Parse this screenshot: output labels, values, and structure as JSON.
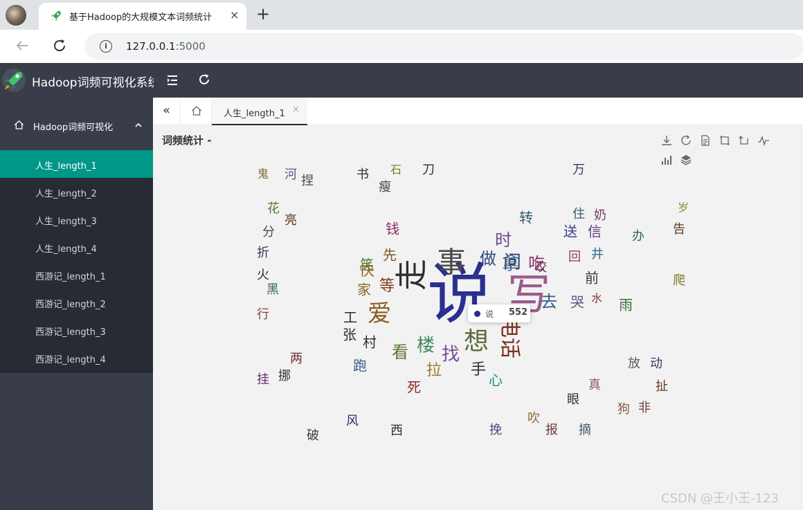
{
  "browser": {
    "tab_title": "基于Hadoop的大规模文本词频统计",
    "tab_close": "×",
    "new_tab": "+",
    "url_host": "127.0.0.1",
    "url_port": ":5000"
  },
  "app": {
    "title": "Hadoop词频可视化系统"
  },
  "sidebar": {
    "group_label": "Hadoop词频可视化",
    "items": [
      {
        "label": "人生_length_1",
        "active": true
      },
      {
        "label": "人生_length_2"
      },
      {
        "label": "人生_length_3"
      },
      {
        "label": "人生_length_4"
      },
      {
        "label": "西游记_length_1"
      },
      {
        "label": "西游记_length_2"
      },
      {
        "label": "西游记_length_3"
      },
      {
        "label": "西游记_length_4"
      }
    ]
  },
  "tabs": {
    "left_arrow": "«",
    "active_tab": "人生_length_1",
    "active_close": "×"
  },
  "chart": {
    "title": "词频统计 -",
    "tooltip": {
      "name": "说",
      "value": "552"
    }
  },
  "watermark": "CSDN @王小王-123",
  "colors": {
    "sidebar_active": "#009688",
    "header_bg": "#393d49",
    "sidebar_bg": "#282b33"
  },
  "chart_data": {
    "type": "wordcloud",
    "words": [
      {
        "text": "说",
        "value": 552,
        "color": "#2b2f8e"
      },
      {
        "text": "写",
        "color": "#9b5b8e"
      },
      {
        "text": "事",
        "color": "#4a4a4a"
      },
      {
        "text": "走",
        "color": "#2e2e2e"
      },
      {
        "text": "爱",
        "color": "#8a5b1e"
      },
      {
        "text": "想",
        "color": "#5a6a3a"
      },
      {
        "text": "电话",
        "color": "#7a2e1e"
      },
      {
        "text": "拿",
        "color": "#3b6c8a"
      },
      {
        "text": "吃",
        "color": "#8a2e6a"
      },
      {
        "text": "问",
        "color": "#3b3b6c"
      },
      {
        "text": "做",
        "color": "#2e4a8a"
      },
      {
        "text": "时",
        "color": "#6a4a8a"
      },
      {
        "text": "找",
        "color": "#7a4a9a"
      },
      {
        "text": "楼",
        "color": "#3b8a5a"
      },
      {
        "text": "去",
        "color": "#2e5a8a"
      },
      {
        "text": "快",
        "color": "#9a6a1e"
      },
      {
        "text": "看",
        "color": "#5a7a2e"
      },
      {
        "text": "等",
        "color": "#8a3b1e"
      },
      {
        "text": "拉",
        "color": "#9a7a1e"
      },
      {
        "text": "手",
        "color": "#2e2e2e"
      },
      {
        "text": "心",
        "color": "#1e8a8a"
      },
      {
        "text": "死",
        "color": "#8a2e2e"
      },
      {
        "text": "村",
        "color": "#2e2e2e"
      },
      {
        "text": "跑",
        "color": "#3b5a8a"
      },
      {
        "text": "家",
        "color": "#8a6a1e"
      },
      {
        "text": "笑",
        "color": "#4a7a2e"
      },
      {
        "text": "先",
        "color": "#7a5a1e"
      },
      {
        "text": "送",
        "color": "#3b3b8a"
      },
      {
        "text": "信",
        "color": "#5a3b8a"
      },
      {
        "text": "井",
        "color": "#2e6a8a"
      },
      {
        "text": "前",
        "color": "#3b3b3b"
      },
      {
        "text": "回",
        "color": "#8a3b6a"
      },
      {
        "text": "哭",
        "color": "#5a5a8a"
      },
      {
        "text": "水",
        "color": "#8a3b3b"
      },
      {
        "text": "雨",
        "color": "#3b6a3b"
      },
      {
        "text": "钱",
        "color": "#8a2e6a"
      },
      {
        "text": "吹",
        "color": "#8a6a3b"
      },
      {
        "text": "眼",
        "color": "#2e2e2e"
      },
      {
        "text": "狗",
        "color": "#8a5a3b"
      },
      {
        "text": "报",
        "color": "#6a3b3b"
      },
      {
        "text": "摘",
        "color": "#3b5a6a"
      },
      {
        "text": "挽",
        "color": "#4a4a8a"
      },
      {
        "text": "破",
        "color": "#3b3b3b"
      },
      {
        "text": "风",
        "color": "#2e2e6a"
      },
      {
        "text": "西",
        "color": "#2e2e2e"
      },
      {
        "text": "挂",
        "color": "#6a2e6a"
      },
      {
        "text": "挪",
        "color": "#2e2e2e"
      },
      {
        "text": "两",
        "color": "#6a2e2e"
      },
      {
        "text": "行",
        "color": "#7a4a2e"
      },
      {
        "text": "火",
        "color": "#2e2e2e"
      },
      {
        "text": "折",
        "color": "#3b3b5a"
      },
      {
        "text": "分",
        "color": "#4a4a4a"
      },
      {
        "text": "花",
        "color": "#4a7a2e"
      },
      {
        "text": "河",
        "color": "#5a5a8a"
      },
      {
        "text": "鬼",
        "color": "#7a6a2e"
      },
      {
        "text": "捏",
        "color": "#4a4a4a"
      },
      {
        "text": "书",
        "color": "#2e2e2e"
      },
      {
        "text": "瘦",
        "color": "#4a4a4a"
      },
      {
        "text": "石",
        "color": "#7a7a1e"
      },
      {
        "text": "刀",
        "color": "#2e2e2e"
      },
      {
        "text": "万",
        "color": "#3b3b5a"
      },
      {
        "text": "住",
        "color": "#2e5a6a"
      },
      {
        "text": "奶",
        "color": "#6a3b6a"
      },
      {
        "text": "告",
        "color": "#5a3b1e"
      },
      {
        "text": "岁",
        "color": "#8a8a3b"
      },
      {
        "text": "办",
        "color": "#2e6a4a"
      },
      {
        "text": "爬",
        "color": "#7a7a1e"
      },
      {
        "text": "放",
        "color": "#5a5a5a"
      },
      {
        "text": "动",
        "color": "#3b3b5a"
      },
      {
        "text": "扯",
        "color": "#6a3b1e"
      },
      {
        "text": "真",
        "color": "#8a5a6a"
      },
      {
        "text": "非",
        "color": "#6a3b3b"
      },
      {
        "text": "亮",
        "color": "#5a3b1e"
      },
      {
        "text": "黑",
        "color": "#3b6a3b"
      },
      {
        "text": "工",
        "color": "#2e2e2e"
      },
      {
        "text": "张",
        "color": "#2e2e2e"
      },
      {
        "text": "转",
        "color": "#2e5a6a"
      },
      {
        "text": "咬",
        "color": "#6a2e4a"
      }
    ]
  }
}
